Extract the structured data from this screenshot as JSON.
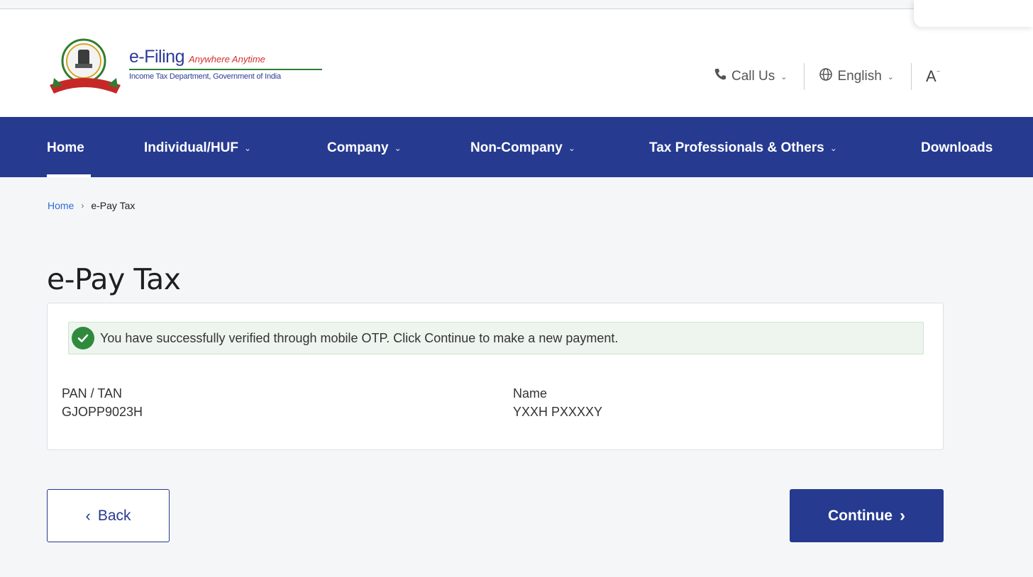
{
  "brand": {
    "title": "e-Filing",
    "tagline": "Anywhere Anytime",
    "subtitle": "Income Tax Department, Government of India"
  },
  "utility": {
    "call_us": "Call Us",
    "language": "English",
    "font_size": "A"
  },
  "nav": {
    "items": [
      {
        "label": "Home"
      },
      {
        "label": "Individual/HUF"
      },
      {
        "label": "Company"
      },
      {
        "label": "Non-Company"
      },
      {
        "label": "Tax Professionals & Others"
      },
      {
        "label": "Downloads"
      }
    ]
  },
  "breadcrumb": {
    "home": "Home",
    "current": "e-Pay Tax"
  },
  "page": {
    "title": "e-Pay Tax"
  },
  "alert": {
    "message": "You have successfully verified through mobile OTP. Click Continue to make a new payment."
  },
  "details": {
    "pan_label": "PAN / TAN",
    "pan_value": "GJOPP9023H",
    "name_label": "Name",
    "name_value": "YXXH PXXXXY"
  },
  "actions": {
    "back": "Back",
    "continue": "Continue"
  },
  "colors": {
    "nav_bg": "#263a90",
    "brand_blue": "#2f3a98",
    "success_green": "#2e8b3e"
  }
}
